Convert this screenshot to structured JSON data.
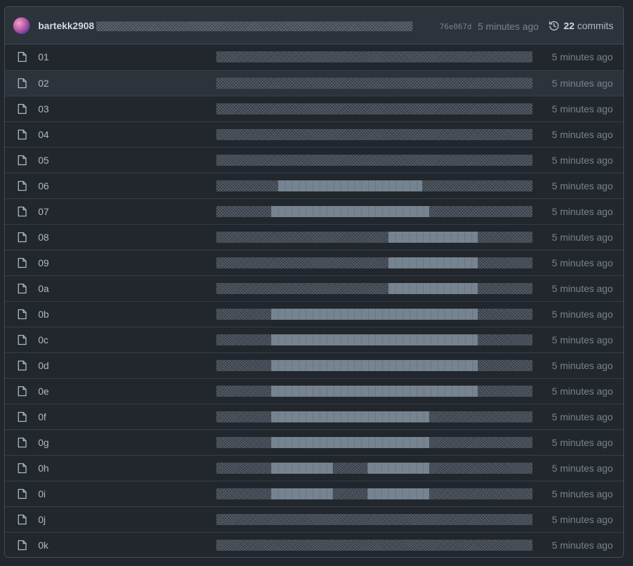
{
  "commit": {
    "author": "bartekk2908",
    "sha": "76e067d",
    "time": "5 minutes ago",
    "count": "22",
    "count_label": "commits",
    "icons": {
      "avatar": "user-avatar",
      "history": "history-icon"
    }
  },
  "files": [
    {
      "name": "01",
      "time": "5 minutes ago",
      "blocks": []
    },
    {
      "name": "02",
      "time": "5 minutes ago",
      "blocks": []
    },
    {
      "name": "03",
      "time": "5 minutes ago",
      "blocks": []
    },
    {
      "name": "04",
      "time": "5 minutes ago",
      "blocks": []
    },
    {
      "name": "05",
      "time": "5 minutes ago",
      "blocks": []
    },
    {
      "name": "06",
      "time": "5 minutes ago",
      "blocks": [
        [
          0.195,
          0.652
        ]
      ]
    },
    {
      "name": "07",
      "time": "5 minutes ago",
      "blocks": [
        [
          0.173,
          0.674
        ]
      ]
    },
    {
      "name": "08",
      "time": "5 minutes ago",
      "blocks": [
        [
          0.543,
          0.826
        ]
      ]
    },
    {
      "name": "09",
      "time": "5 minutes ago",
      "blocks": [
        [
          0.543,
          0.826
        ]
      ]
    },
    {
      "name": "0a",
      "time": "5 minutes ago",
      "blocks": [
        [
          0.543,
          0.826
        ]
      ]
    },
    {
      "name": "0b",
      "time": "5 minutes ago",
      "blocks": [
        [
          0.173,
          0.826
        ]
      ]
    },
    {
      "name": "0c",
      "time": "5 minutes ago",
      "blocks": [
        [
          0.173,
          0.826
        ]
      ]
    },
    {
      "name": "0d",
      "time": "5 minutes ago",
      "blocks": [
        [
          0.173,
          0.826
        ]
      ]
    },
    {
      "name": "0e",
      "time": "5 minutes ago",
      "blocks": [
        [
          0.173,
          0.826
        ]
      ]
    },
    {
      "name": "0f",
      "time": "5 minutes ago",
      "blocks": [
        [
          0.173,
          0.674
        ]
      ]
    },
    {
      "name": "0g",
      "time": "5 minutes ago",
      "blocks": [
        [
          0.173,
          0.674
        ]
      ]
    },
    {
      "name": "0h",
      "time": "5 minutes ago",
      "blocks": [
        [
          0.173,
          0.369
        ],
        [
          0.478,
          0.674
        ]
      ]
    },
    {
      "name": "0i",
      "time": "5 minutes ago",
      "blocks": [
        [
          0.173,
          0.369
        ],
        [
          0.478,
          0.674
        ]
      ]
    },
    {
      "name": "0j",
      "time": "5 minutes ago",
      "blocks": []
    },
    {
      "name": "0k",
      "time": "5 minutes ago",
      "blocks": []
    }
  ],
  "highlighted_row": "02",
  "colors": {
    "background": "#22272e",
    "header": "#2d333b",
    "border": "#444c56",
    "block": "#768390",
    "muted_text": "#768390"
  }
}
